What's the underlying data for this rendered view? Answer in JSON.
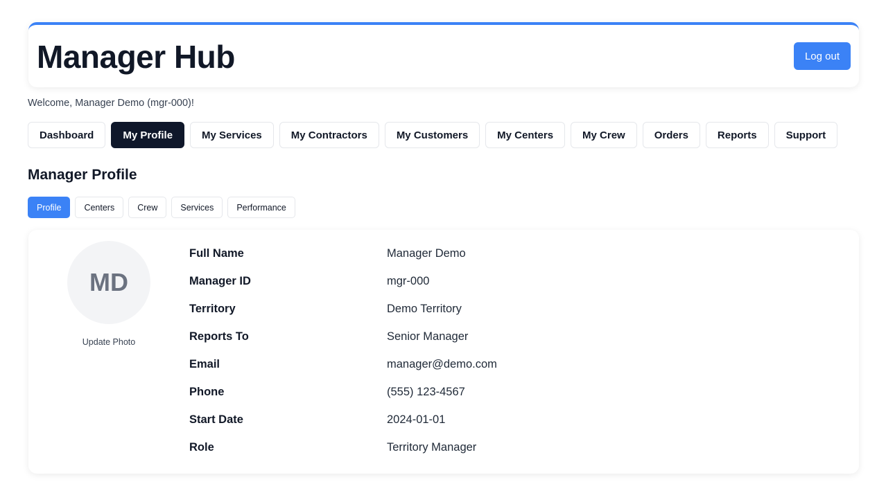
{
  "header": {
    "title": "Manager Hub",
    "logout_label": "Log out"
  },
  "welcome_text": "Welcome, Manager Demo (mgr-000)!",
  "nav": {
    "items": [
      {
        "label": "Dashboard",
        "active": false
      },
      {
        "label": "My Profile",
        "active": true
      },
      {
        "label": "My Services",
        "active": false
      },
      {
        "label": "My Contractors",
        "active": false
      },
      {
        "label": "My Customers",
        "active": false
      },
      {
        "label": "My Centers",
        "active": false
      },
      {
        "label": "My Crew",
        "active": false
      },
      {
        "label": "Orders",
        "active": false
      },
      {
        "label": "Reports",
        "active": false
      },
      {
        "label": "Support",
        "active": false
      }
    ]
  },
  "section_title": "Manager Profile",
  "sub_tabs": {
    "items": [
      {
        "label": "Profile",
        "active": true
      },
      {
        "label": "Centers",
        "active": false
      },
      {
        "label": "Crew",
        "active": false
      },
      {
        "label": "Services",
        "active": false
      },
      {
        "label": "Performance",
        "active": false
      }
    ]
  },
  "profile": {
    "initials": "MD",
    "update_photo_label": "Update Photo",
    "fields": [
      {
        "label": "Full Name",
        "value": "Manager Demo"
      },
      {
        "label": "Manager ID",
        "value": "mgr-000"
      },
      {
        "label": "Territory",
        "value": "Demo Territory"
      },
      {
        "label": "Reports To",
        "value": "Senior Manager"
      },
      {
        "label": "Email",
        "value": "manager@demo.com"
      },
      {
        "label": "Phone",
        "value": "(555) 123-4567"
      },
      {
        "label": "Start Date",
        "value": "2024-01-01"
      },
      {
        "label": "Role",
        "value": "Territory Manager"
      }
    ]
  },
  "colors": {
    "accent": "#3b82f6",
    "nav_active": "#0f172a",
    "avatar_bg": "#f3f4f6",
    "avatar_text": "#6b7280"
  }
}
